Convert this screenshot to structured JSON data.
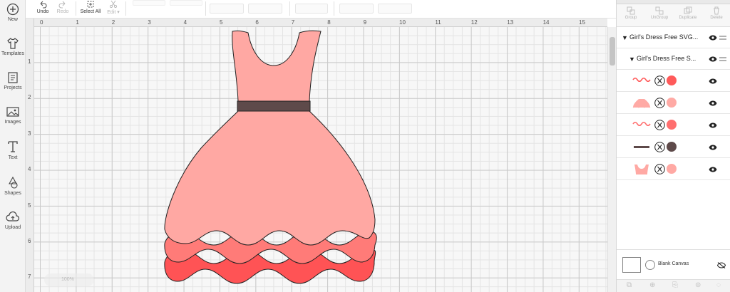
{
  "nav": [
    {
      "label": "New",
      "icon": "plus-circle-icon"
    },
    {
      "label": "Templates",
      "icon": "shirt-icon"
    },
    {
      "label": "Projects",
      "icon": "projects-icon"
    },
    {
      "label": "Images",
      "icon": "image-icon"
    },
    {
      "label": "Text",
      "icon": "text-t-icon"
    },
    {
      "label": "Shapes",
      "icon": "shapes-icon"
    },
    {
      "label": "Upload",
      "icon": "upload-cloud-icon"
    }
  ],
  "toolbar": {
    "undo": "Undo",
    "redo": "Redo",
    "select_all": "Select All",
    "edit": "Edit"
  },
  "ruler": {
    "top_ticks": [
      "0",
      "1",
      "2",
      "3",
      "4",
      "5",
      "6",
      "7",
      "8",
      "9",
      "10",
      "11",
      "12",
      "13",
      "14",
      "15"
    ],
    "left_ticks": [
      "1",
      "2",
      "3",
      "4",
      "5",
      "6",
      "7"
    ]
  },
  "zoom": "100%",
  "panel": {
    "actions": [
      "Group",
      "UnGroup",
      "Duplicate",
      "Delete"
    ],
    "group1": "Girl's Dress Free SVG...",
    "group2": "Girl's Dress Free S...",
    "layers": [
      {
        "swatch_color": "#ff5a5a",
        "thumb": "wavy-ruffle-thumb"
      },
      {
        "swatch_color": "#ffaaa5",
        "thumb": "skirt-thumb"
      },
      {
        "swatch_color": "#ff6f6f",
        "thumb": "wavy-ruffle-thumb"
      },
      {
        "swatch_color": "#5e4a4a",
        "thumb": "belt-thumb"
      },
      {
        "swatch_color": "#ffa9a4",
        "thumb": "bodice-thumb"
      }
    ],
    "blank_canvas": "Blank Canvas"
  },
  "colors": {
    "bodice": "#ffa8a3",
    "belt": "#5e4a4a",
    "skirt": "#ffa8a3",
    "ruffle_mid": "#ff7b78",
    "ruffle_bottom": "#ff5355"
  }
}
